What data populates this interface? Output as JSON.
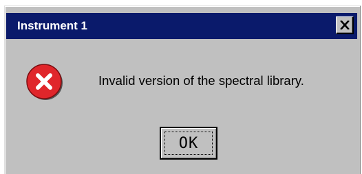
{
  "dialog": {
    "title": "Instrument 1",
    "message": "Invalid version of the spectral library.",
    "ok_label": "OK",
    "icon": "error-icon",
    "close_icon": "close-icon"
  },
  "colors": {
    "titlebar": "#0a1a6b",
    "window_bg": "#c0c0c0",
    "error_red": "#e0262b"
  }
}
